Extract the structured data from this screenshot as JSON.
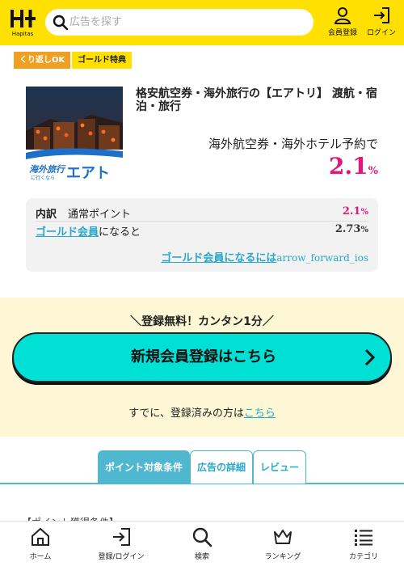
{
  "header": {
    "logo_text": "Hapitas",
    "search_placeholder": "広告を探す",
    "member_label": "会員登録",
    "login_label": "ログイン"
  },
  "badges": {
    "repeat": "くり返しOK",
    "gold": "ゴールド特典"
  },
  "product": {
    "title": "格安航空券・海外旅行の【エアトリ】 渡航・宿泊・旅行",
    "subtitle": "海外航空券・海外ホテル予約で",
    "rate_value": "2.1",
    "rate_unit": "%",
    "thumb_caption_1": "海外旅行",
    "thumb_caption_2": "に行くなら",
    "thumb_brand": "エアトリ"
  },
  "breakdown": {
    "label": "内訳",
    "normal_label": "通常ポイント",
    "normal_rate": "2.1",
    "normal_unit": "%",
    "gold_link": "ゴールド会員",
    "gold_suffix": "になると",
    "gold_rate": "2.73",
    "gold_unit": "%",
    "become_gold_link": "ゴールド会員になるには",
    "become_gold_icon_text": "arrow_forward_ios"
  },
  "register": {
    "catch": "＼登録無料！カンタン1分／",
    "button_label": "新規会員登録はこちら",
    "login_prefix": "すでに、登録済みの方は",
    "login_link": "こちら"
  },
  "tabs": [
    {
      "label": "ポイント対象条件"
    },
    {
      "label": "広告の詳細"
    },
    {
      "label": "レビュー"
    }
  ],
  "section_peek": "【ポイント獲得条件】",
  "bottom_nav": [
    {
      "label": "ホーム"
    },
    {
      "label": "登録/ログイン"
    },
    {
      "label": "検索"
    },
    {
      "label": "ランキング"
    },
    {
      "label": "カテゴリ"
    }
  ],
  "colors": {
    "brand_yellow": "#ffe000",
    "accent_pink": "#e0187c",
    "link_blue": "#29a8c8",
    "cta_teal": "#00e0d4",
    "badge_orange": "#f0a020"
  }
}
